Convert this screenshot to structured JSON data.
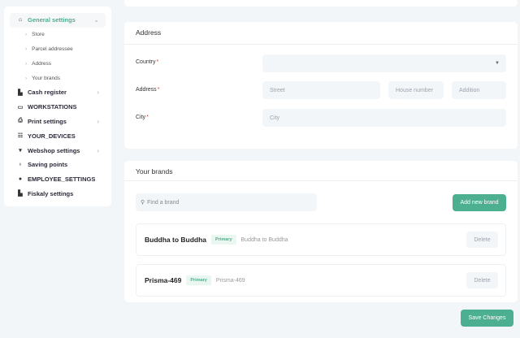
{
  "sidebar": {
    "items": [
      {
        "label": "General settings",
        "icon": "home-icon",
        "active": true
      },
      {
        "label": "Cash register",
        "icon": "cash-register-icon"
      },
      {
        "label": "WORKSTATIONS",
        "icon": "monitor-icon"
      },
      {
        "label": "Print settings",
        "icon": "printer-icon"
      },
      {
        "label": "YOUR_DEVICES",
        "icon": "devices-icon"
      },
      {
        "label": "Webshop settings",
        "icon": "cart-icon"
      },
      {
        "label": "Saving points",
        "icon": "award-icon"
      },
      {
        "label": "EMPLOYEE_SETTINGS",
        "icon": "user-icon"
      },
      {
        "label": "Fiskaly settings",
        "icon": "building-icon"
      }
    ],
    "subitems": [
      "Store",
      "Parcel addressee",
      "Address",
      "Your brands"
    ]
  },
  "address": {
    "title": "Address",
    "country_label": "Country",
    "address_label": "Address",
    "city_label": "City",
    "street_placeholder": "Street",
    "house_placeholder": "House number",
    "addition_placeholder": "Addition",
    "city_placeholder": "City"
  },
  "brands": {
    "title": "Your brands",
    "search_placeholder": "Find a brand",
    "add_label": "Add new brand",
    "items": [
      {
        "name": "Buddha to Buddha",
        "badge": "Primary",
        "sub": "Buddha to Buddha",
        "delete": "Delete"
      },
      {
        "name": "Prisma-469",
        "badge": "Primary",
        "sub": "Prisma-469",
        "delete": "Delete"
      }
    ]
  },
  "save_label": "Save Changes",
  "colors": {
    "accent": "#4caf8f",
    "required": "#e53935"
  }
}
